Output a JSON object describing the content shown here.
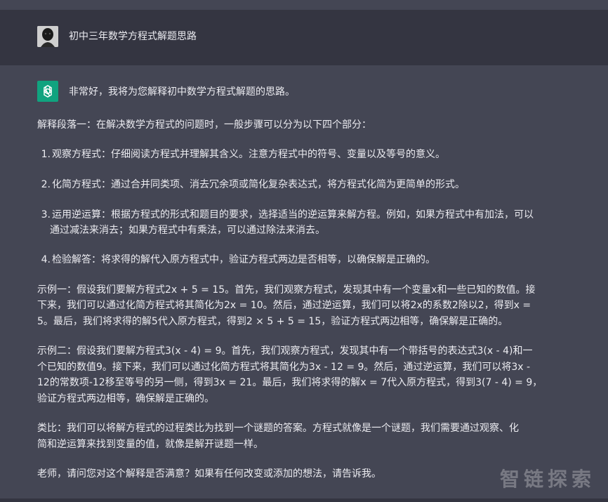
{
  "user_message": {
    "text": "初中三年数学方程式解题思路"
  },
  "assistant_message": {
    "intro": "非常好，我将为您解释初中数学方程式解题的思路。",
    "paragraph1": "解释段落一：在解决数学方程式的问题时，一般步骤可以分为以下四个部分：",
    "steps": [
      {
        "num": "1.",
        "text": "观察方程式：仔细阅读方程式并理解其含义。注意方程式中的符号、变量以及等号的意义。"
      },
      {
        "num": "2.",
        "text": "化简方程式：通过合并同类项、消去冗余项或简化复杂表达式，将方程式化简为更简单的形式。"
      },
      {
        "num": "3.",
        "line1": "运用逆运算：根据方程式的形式和题目的要求，选择适当的逆运算来解方程。例如，如果方程式中有加法，可以",
        "line2": "通过减法来消去；如果方程式中有乘法，可以通过除法来消去。"
      },
      {
        "num": "4.",
        "text": "检验解答：将求得的解代入原方程式中，验证方程式两边是否相等，以确保解是正确的。"
      }
    ],
    "example1": [
      "示例一：假设我们要解方程式2x + 5 = 15。首先，我们观察方程式，发现其中有一个变量x和一些已知的数值。接",
      "下来，我们可以通过化简方程式将其简化为2x = 10。然后，通过逆运算，我们可以将2x的系数2除以2，得到x =",
      "5。最后，我们将求得的解5代入原方程式，得到2 × 5 + 5 = 15，验证方程式两边相等，确保解是正确的。"
    ],
    "example2": [
      "示例二：假设我们要解方程式3(x - 4) = 9。首先，我们观察方程式，发现其中有一个带括号的表达式3(x - 4)和一",
      "个已知的数值9。接下来，我们可以通过化简方程式将其简化为3x - 12 = 9。然后，通过逆运算，我们可以将3x -",
      "12的常数项-12移至等号的另一侧，得到3x = 21。最后，我们将求得的解x = 7代入原方程式，得到3(7 - 4) = 9，",
      "验证方程式两边相等，确保解是正确的。"
    ],
    "analogy": [
      "类比：我们可以将解方程式的过程类比为找到一个谜题的答案。方程式就像是一个谜题，我们需要通过观察、化",
      "简和逆运算来找到变量的值，就像是解开谜题一样。"
    ],
    "closing": "老师，请问您对这个解释是否满意？如果有任何改变或添加的想法，请告诉我。"
  },
  "watermark": "智链探索",
  "colors": {
    "user_bg": "#343541",
    "assistant_bg": "#444654",
    "gpt_green": "#10a37f",
    "text": "#ececf1"
  }
}
